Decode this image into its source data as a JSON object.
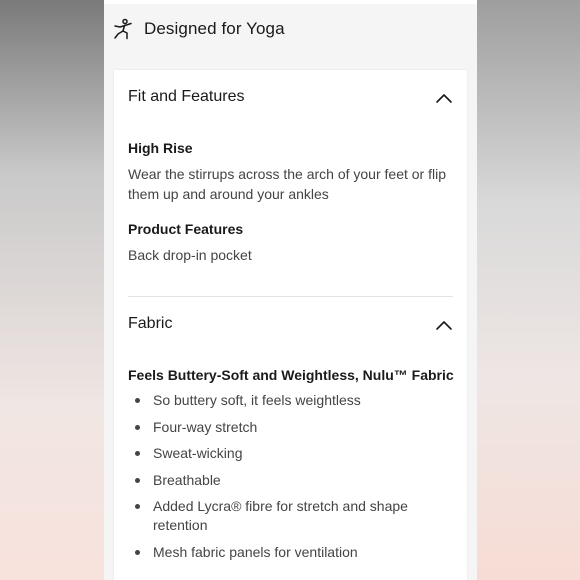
{
  "header": {
    "icon": "yoga-pose-icon",
    "title": "Designed for Yoga"
  },
  "sections": [
    {
      "title": "Fit and Features",
      "icon": "chevron-up-icon",
      "expanded": true,
      "items": [
        {
          "heading": "High Rise",
          "text": "Wear the stirrups across the arch of your feet or flip them up and around your ankles"
        },
        {
          "heading": "Product Features",
          "text": "Back drop-in pocket"
        }
      ]
    },
    {
      "title": "Fabric",
      "icon": "chevron-up-icon",
      "expanded": true,
      "heading": "Feels Buttery-Soft and Weightless, Nulu™ Fabric",
      "bullets": [
        "So buttery soft, it feels weightless",
        "Four-way stretch",
        "Sweat-wicking",
        "Breathable",
        "Added Lycra® fibre for stretch and shape retention",
        "Mesh fabric panels for ventilation"
      ]
    }
  ],
  "colors": {
    "text_primary": "#1a1a1a",
    "text_secondary": "#444444",
    "divider": "#e3e3e3",
    "card_background": "#ffffff",
    "page_background": "#f5f5f5"
  }
}
